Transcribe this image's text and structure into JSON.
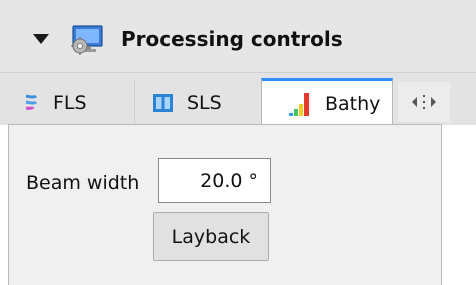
{
  "header": {
    "title": "Processing controls",
    "icon": "processing-settings-icon"
  },
  "tabs": [
    {
      "label": "FLS",
      "icon": "fls-sonar-icon",
      "active": false
    },
    {
      "label": "SLS",
      "icon": "sls-sonar-icon",
      "active": false
    },
    {
      "label": "Bathy",
      "icon": "bathy-bars-icon",
      "active": true
    }
  ],
  "bathy": {
    "beam_width_label": "Beam width",
    "beam_width_value": "20.0 °",
    "layback_label": "Layback"
  },
  "colors": {
    "active_tab_accent": "#2f8ef5",
    "header_bg": "#e6e6e6",
    "content_bg": "#f0f0f0"
  }
}
